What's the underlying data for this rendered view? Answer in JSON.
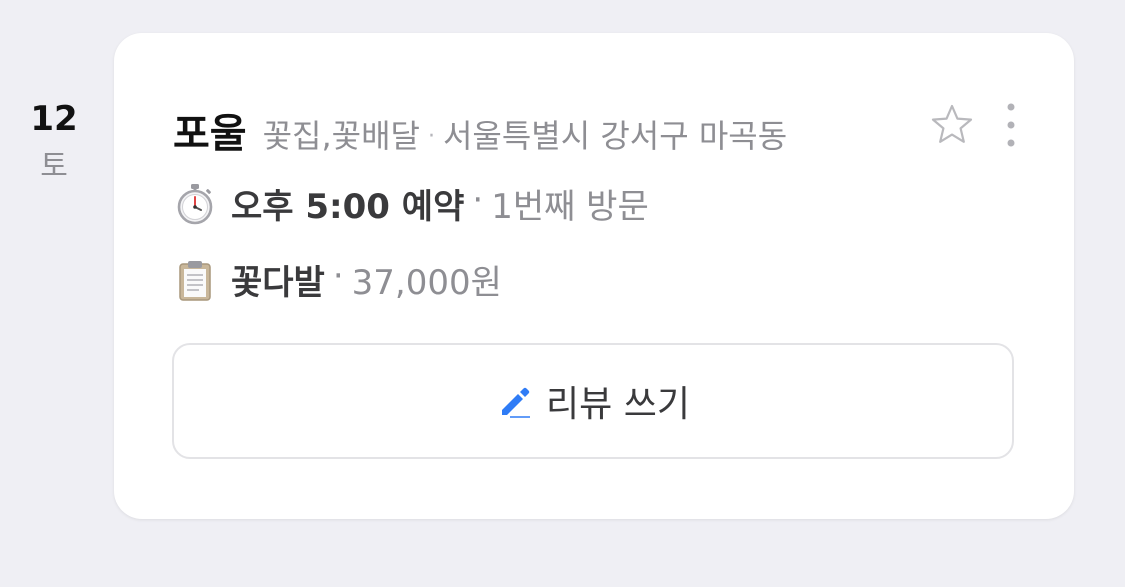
{
  "date": {
    "day": "12",
    "weekday": "토"
  },
  "shop": {
    "name": "포울",
    "category": "꽃집,꽃배달",
    "location": "서울특별시 강서구 마곡동",
    "separator": "·"
  },
  "reservation": {
    "icon": "stopwatch-icon",
    "time": "오후 5:00 예약",
    "visit_count": "1번째 방문"
  },
  "order": {
    "icon": "clipboard-icon",
    "item": "꽃다발",
    "price": "37,000원"
  },
  "actions": {
    "favorite_icon": "star-outline-icon",
    "more_icon": "vertical-dots-icon",
    "review_icon": "pencil-icon",
    "review_label": "리뷰 쓰기"
  },
  "colors": {
    "background": "#efeff4",
    "card": "#ffffff",
    "accent_blue": "#2f7cf6",
    "muted_text": "#8e8e93"
  }
}
